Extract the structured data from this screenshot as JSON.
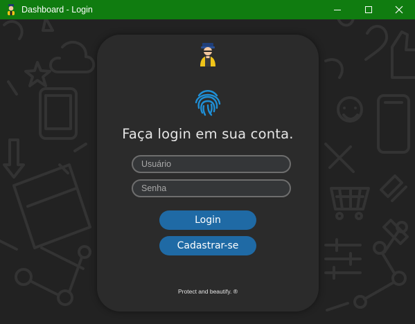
{
  "window": {
    "title": "Dashboard - Login",
    "titlebar_color": "#107c10"
  },
  "login": {
    "heading": "Faça login em sua conta.",
    "username_placeholder": "Usuário",
    "password_placeholder": "Senha",
    "login_label": "Login",
    "register_label": "Cadastrar-se",
    "footer": "Protect and beautify. ®"
  },
  "colors": {
    "card_bg": "#2b2b2b",
    "button": "#1f6aa5",
    "fingerprint": "#1f8fd6"
  },
  "icons": [
    "user-avatar-icon",
    "fingerprint-icon",
    "minimize-icon",
    "maximize-icon",
    "close-icon"
  ]
}
